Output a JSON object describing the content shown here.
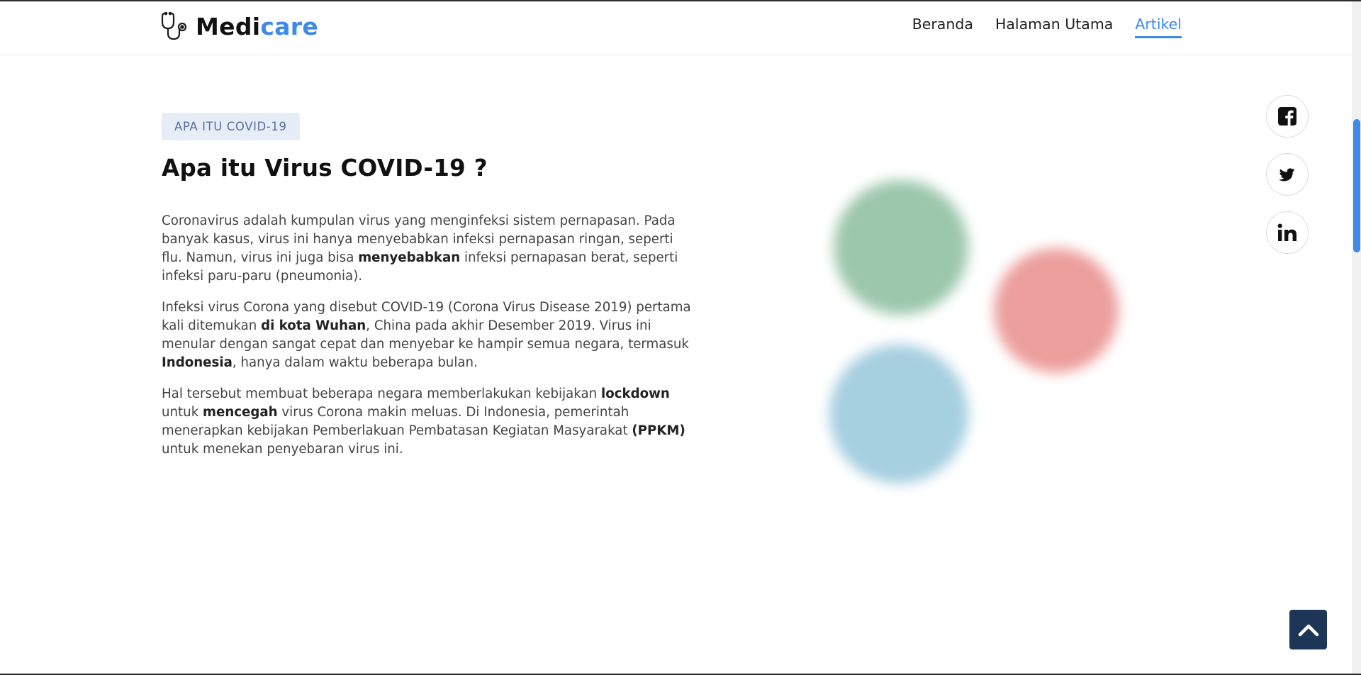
{
  "header": {
    "logo": {
      "text_main": "Medi",
      "text_accent": "care",
      "icon": "stethoscope-icon"
    },
    "nav": [
      {
        "label": "Beranda",
        "active": false
      },
      {
        "label": "Halaman Utama",
        "active": false
      },
      {
        "label": "Artikel",
        "active": true
      }
    ]
  },
  "article": {
    "tag": "APA ITU COVID-19",
    "title": "Apa itu Virus COVID-19 ?",
    "paragraphs": [
      [
        {
          "text": "Coronavirus adalah kumpulan virus yang menginfeksi sistem pernapasan. Pada banyak kasus, virus ini hanya menyebabkan infeksi pernapasan ringan, seperti flu. Namun, virus ini juga bisa "
        },
        {
          "text": "menyebabkan",
          "bold": true
        },
        {
          "text": " infeksi pernapasan berat, seperti infeksi paru-paru (pneumonia)."
        }
      ],
      [
        {
          "text": "Infeksi virus Corona yang disebut COVID-19 (Corona Virus Disease 2019) pertama kali ditemukan "
        },
        {
          "text": "di kota Wuhan",
          "bold": true
        },
        {
          "text": ", China pada akhir Desember 2019. Virus ini menular dengan sangat cepat dan menyebar ke hampir semua negara, termasuk "
        },
        {
          "text": "Indonesia",
          "bold": true
        },
        {
          "text": ", hanya dalam waktu beberapa bulan."
        }
      ],
      [
        {
          "text": "Hal tersebut membuat beberapa negara memberlakukan kebijakan "
        },
        {
          "text": "lockdown",
          "bold": true
        },
        {
          "text": " untuk "
        },
        {
          "text": "mencegah",
          "bold": true
        },
        {
          "text": " virus Corona makin meluas. Di Indonesia, pemerintah menerapkan kebijakan Pemberlakuan Pembatasan Kegiatan Masyarakat "
        },
        {
          "text": "(PPKM)",
          "bold": true
        },
        {
          "text": " untuk menekan penyebaran virus ini."
        }
      ]
    ]
  },
  "social": [
    {
      "icon": "facebook-icon"
    },
    {
      "icon": "twitter-icon"
    },
    {
      "icon": "linkedin-icon"
    }
  ],
  "back_to_top": {
    "icon": "chevron-up-icon"
  },
  "colors": {
    "accent": "#3d8ae8",
    "dark_navy": "#1d3557",
    "tag_bg": "#e7edf7",
    "virus_green": "#9cc7ac",
    "virus_red": "#ec9f9d",
    "virus_blue": "#a6cfe0"
  }
}
